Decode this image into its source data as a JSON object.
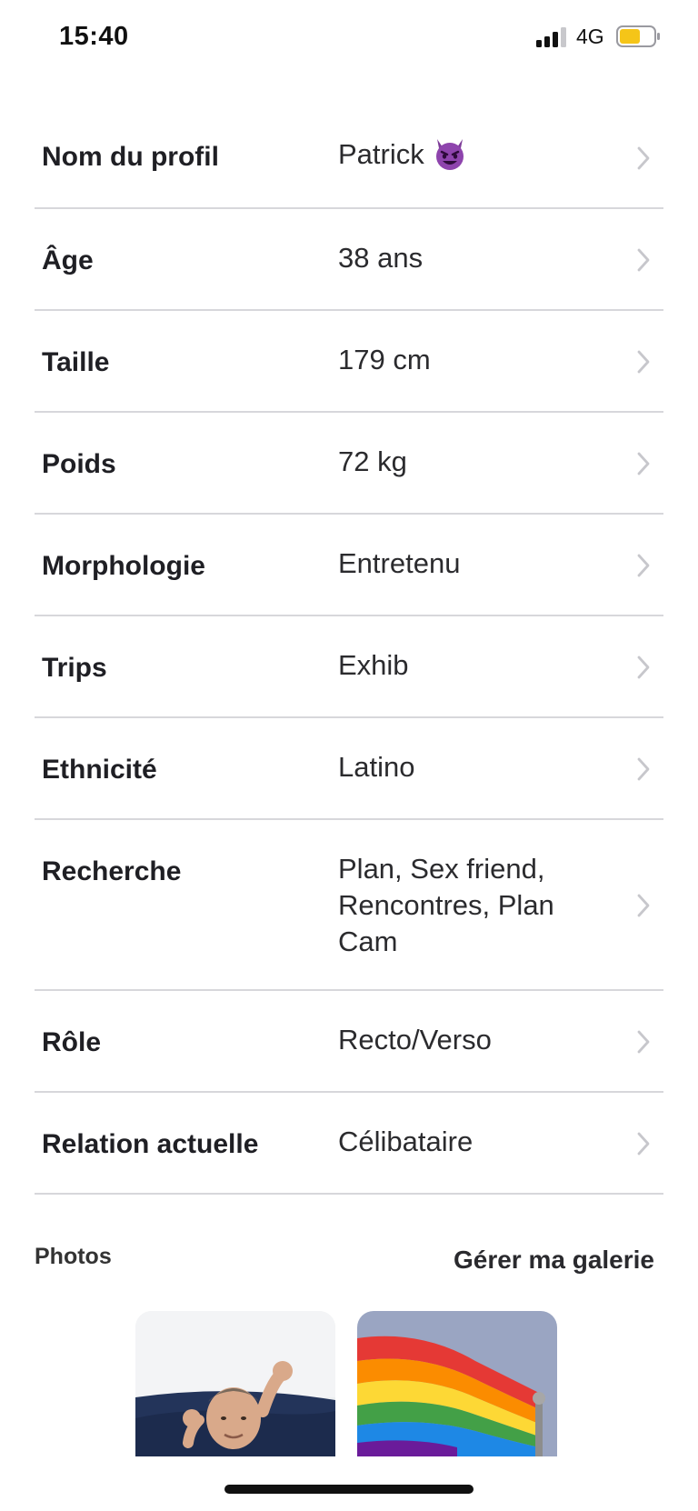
{
  "status_bar": {
    "time": "15:40",
    "network": "4G",
    "icons": [
      "signal-bars-icon",
      "battery-icon"
    ],
    "battery_color": "#f5c518"
  },
  "profile": {
    "rows": [
      {
        "label": "Nom du profil",
        "value": "Patrick",
        "value_emoji": "smiling-devil-emoji-icon"
      },
      {
        "label": "Âge",
        "value": "38 ans"
      },
      {
        "label": "Taille",
        "value": "179 cm"
      },
      {
        "label": "Poids",
        "value": "72 kg"
      },
      {
        "label": "Morphologie",
        "value": "Entretenu"
      },
      {
        "label": "Trips",
        "value": "Exhib"
      },
      {
        "label": "Ethnicité",
        "value": "Latino"
      },
      {
        "label": "Recherche",
        "value_lines": [
          "Plan, Sex friend,",
          "Rencontres, Plan",
          "Cam"
        ]
      },
      {
        "label": "Rôle",
        "value": "Recto/Verso"
      },
      {
        "label": "Relation actuelle",
        "value": "Célibataire"
      }
    ],
    "chevron_icon": "chevron-right-icon"
  },
  "photos": {
    "title": "Photos",
    "manage_label": "Gérer ma galerie",
    "items": [
      {
        "name": "photo-man-stretching"
      },
      {
        "name": "photo-rainbow-flag"
      }
    ]
  },
  "colors": {
    "divider": "#d7d7db",
    "chevron": "#c7c7cc",
    "emoji_purple": "#8e44ad"
  }
}
